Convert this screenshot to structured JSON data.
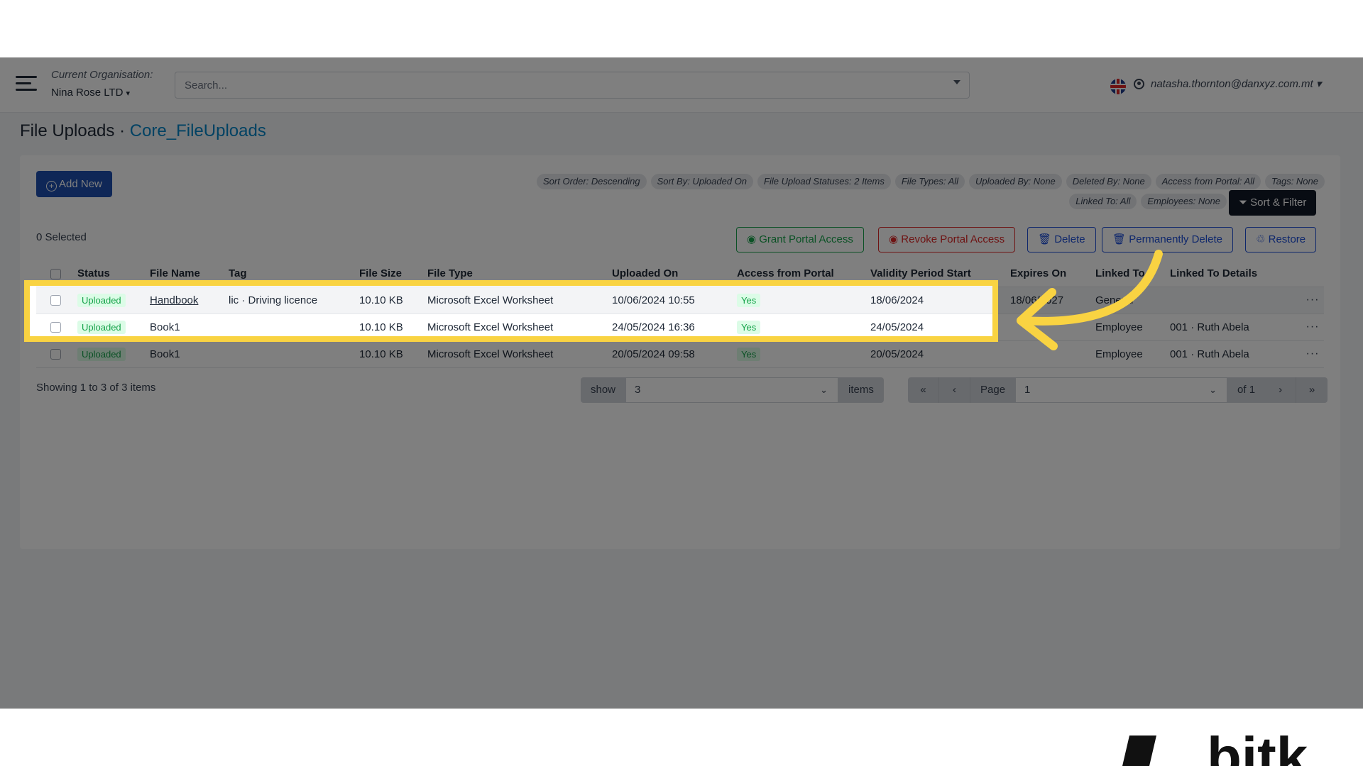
{
  "header": {
    "org_label": "Current Organisation:",
    "org_value": "Nina Rose LTD",
    "search_placeholder": "Search...",
    "user_email": "natasha.thornton@danxyz.com.mt"
  },
  "page": {
    "title": "File Uploads",
    "separator": " · ",
    "subtitle": "Core_FileUploads"
  },
  "toolbar": {
    "add_new": "Add New",
    "sort_filter": "Sort & Filter",
    "selected": "0 Selected"
  },
  "filters": [
    "Sort Order: Descending",
    "Sort By: Uploaded On",
    "File Upload Statuses: 2 Items",
    "File Types: All",
    "Uploaded By: None",
    "Deleted By: None",
    "Access from Portal: All",
    "Tags: None",
    "Linked To: All",
    "Employees: None"
  ],
  "actions": {
    "grant": "Grant Portal Access",
    "revoke": "Revoke Portal Access",
    "delete": "Delete",
    "permanently_delete": "Permanently Delete",
    "restore": "Restore"
  },
  "table": {
    "columns": [
      "Status",
      "File Name",
      "Tag",
      "File Size",
      "File Type",
      "Uploaded On",
      "Access from Portal",
      "Validity Period Start",
      "Expires On",
      "Linked To",
      "Linked To Details"
    ],
    "rows": [
      {
        "status": "Uploaded",
        "file_name": "Handbook",
        "tag": "lic · Driving licence",
        "size": "10.10 KB",
        "type": "Microsoft Excel Worksheet",
        "uploaded_on": "10/06/2024 10:55",
        "portal": "Yes",
        "validity_start": "18/06/2024",
        "expires_on": "18/06/2027",
        "linked_to": "General",
        "linked_details": "",
        "more": "···"
      },
      {
        "status": "Uploaded",
        "file_name": "Book1",
        "tag": "",
        "size": "10.10 KB",
        "type": "Microsoft Excel Worksheet",
        "uploaded_on": "24/05/2024 16:36",
        "portal": "Yes",
        "validity_start": "24/05/2024",
        "expires_on": "",
        "linked_to": "Employee",
        "linked_details": "001 · Ruth Abela",
        "more": "···"
      },
      {
        "status": "Uploaded",
        "file_name": "Book1",
        "tag": "",
        "size": "10.10 KB",
        "type": "Microsoft Excel Worksheet",
        "uploaded_on": "20/05/2024 09:58",
        "portal": "Yes",
        "validity_start": "20/05/2024",
        "expires_on": "",
        "linked_to": "Employee",
        "linked_details": "001 · Ruth Abela",
        "more": "···"
      }
    ]
  },
  "pagination": {
    "showing": "Showing 1 to 3 of 3 items",
    "show_label": "show",
    "show_value": "3",
    "items_label": "items",
    "page_label": "Page",
    "page_value": "1",
    "of_label": "of 1"
  },
  "colors": {
    "highlight": "#f9d342",
    "primary": "#1e4fae",
    "link": "#0284c7"
  }
}
